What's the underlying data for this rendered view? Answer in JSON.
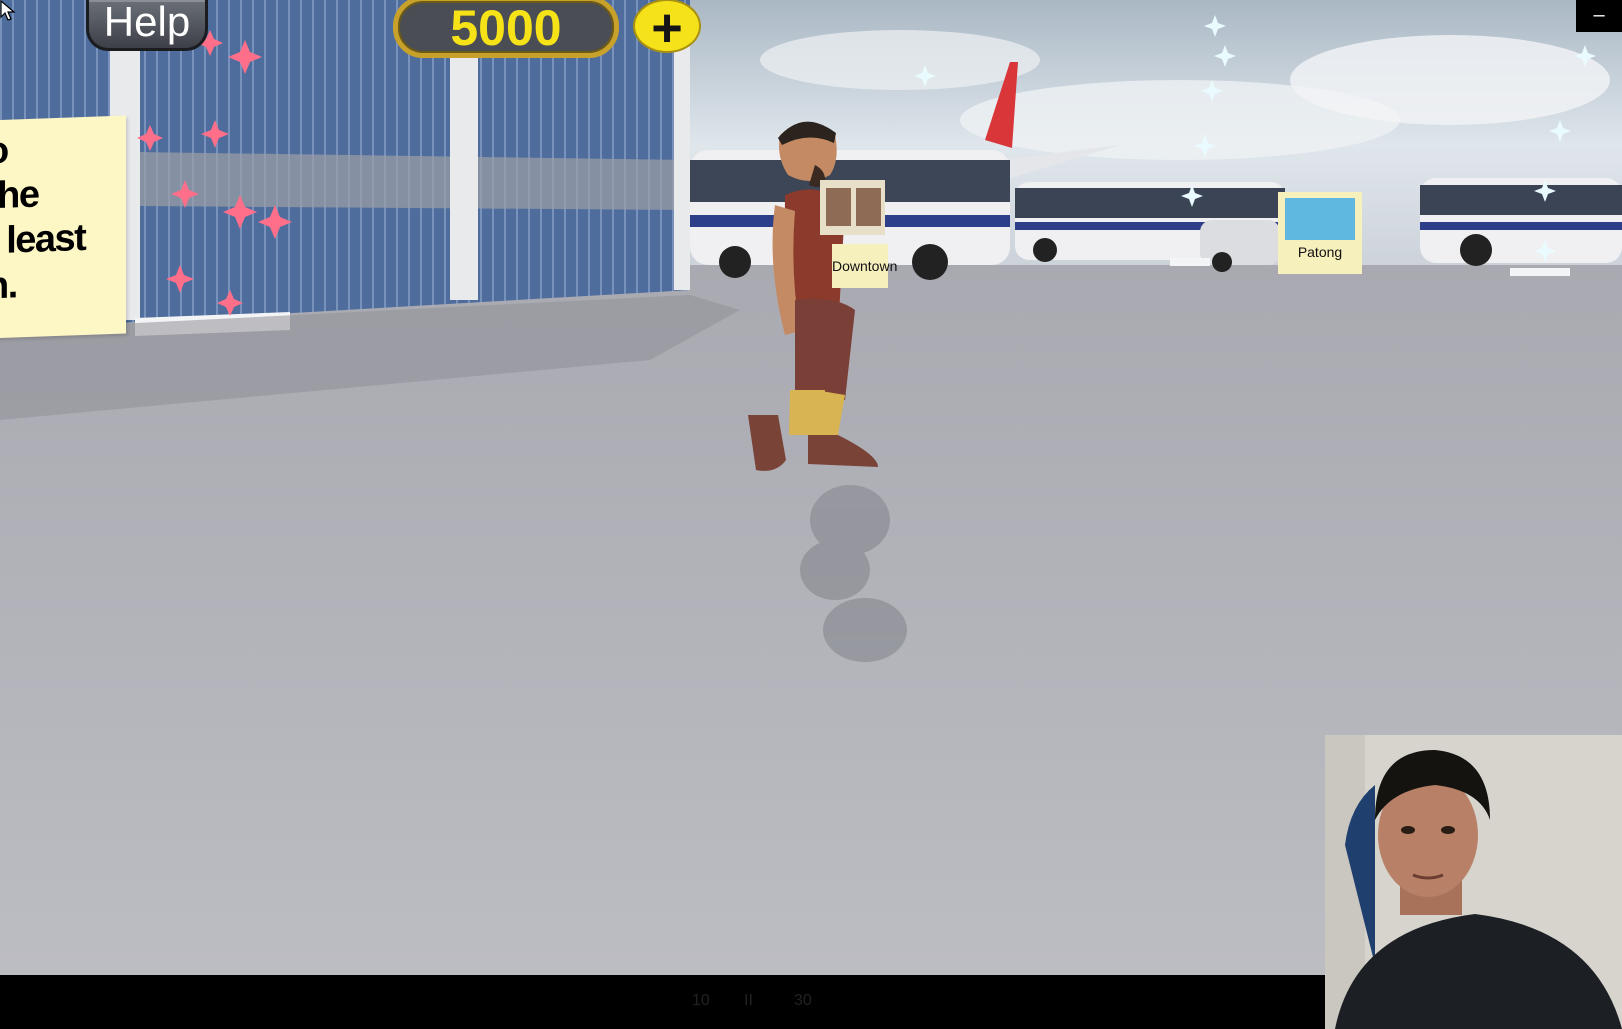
{
  "hud": {
    "help_label": "Help",
    "coins": "5000",
    "add_coins_symbol": "+"
  },
  "signs": {
    "left_board_lines": [
      "o",
      "the",
      "t least",
      "n."
    ],
    "downtown": "Downtown",
    "patong": "Patong"
  },
  "window": {
    "minimize_symbol": "–"
  },
  "player_controls": {
    "rewind": "10",
    "pause": "II",
    "forward": "30"
  },
  "colors": {
    "coin_text": "#f5e318",
    "plus_button": "#f5e21b",
    "ground": "#b6b7bd",
    "sky": "#d9e3ea",
    "sparkle": "#ff6f8a"
  },
  "icons": [
    "plus-icon",
    "minimize-icon",
    "rewind-icon",
    "pause-icon",
    "forward-icon",
    "mouse-cursor-icon"
  ]
}
